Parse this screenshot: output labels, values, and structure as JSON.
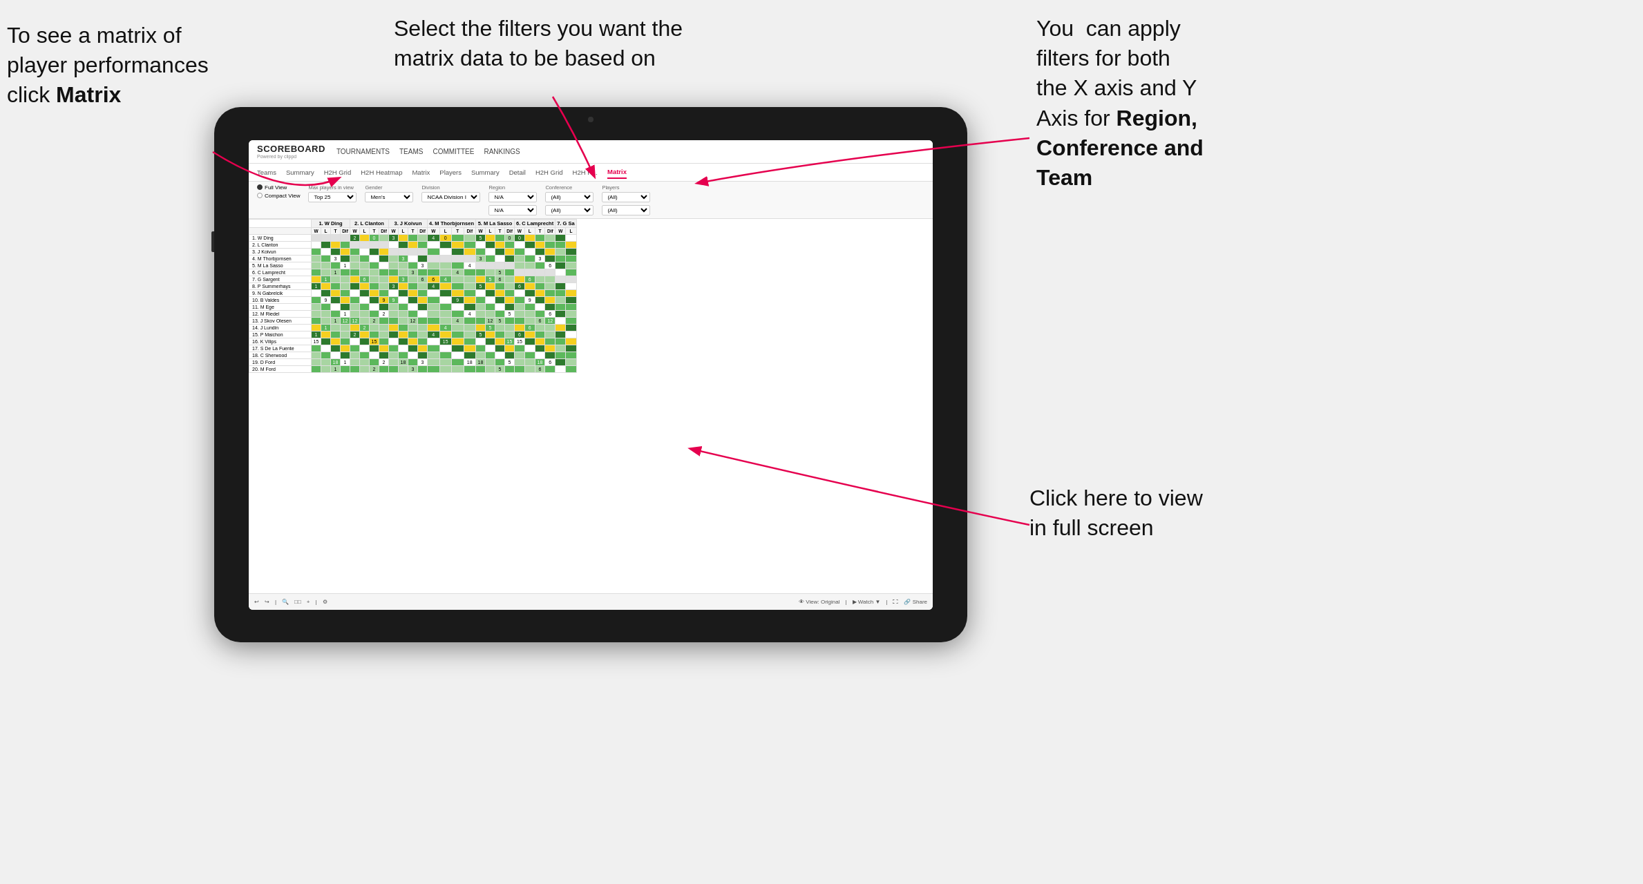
{
  "annotations": {
    "top_left": {
      "line1": "To see a matrix of",
      "line2": "player performances",
      "line3_plain": "click ",
      "line3_bold": "Matrix"
    },
    "top_center": "Select the filters you want the matrix data to be based on",
    "top_right": {
      "line1": "You  can apply",
      "line2": "filters for both",
      "line3": "the X axis and Y",
      "line4_plain": "Axis for ",
      "line4_bold": "Region,",
      "line5_bold": "Conference and",
      "line6_bold": "Team"
    },
    "bottom_right": {
      "line1": "Click here to view",
      "line2": "in full screen"
    }
  },
  "app": {
    "logo_title": "SCOREBOARD",
    "logo_sub": "Powered by clippd",
    "nav_items": [
      "TOURNAMENTS",
      "TEAMS",
      "COMMITTEE",
      "RANKINGS"
    ],
    "sub_nav_items": [
      "Teams",
      "Summary",
      "H2H Grid",
      "H2H Heatmap",
      "Matrix",
      "Players",
      "Summary",
      "Detail",
      "H2H Grid",
      "H2H H...",
      "Matrix"
    ],
    "active_tab": "Matrix"
  },
  "filters": {
    "view_options": [
      "Full View",
      "Compact View"
    ],
    "selected_view": "Full View",
    "max_players_label": "Max players in view",
    "max_players_value": "Top 25",
    "gender_label": "Gender",
    "gender_value": "Men's",
    "division_label": "Division",
    "division_value": "NCAA Division I",
    "region_label": "Region",
    "region_value1": "N/A",
    "region_value2": "N/A",
    "conference_label": "Conference",
    "conference_value1": "(All)",
    "conference_value2": "(All)",
    "players_label": "Players",
    "players_value1": "(All)",
    "players_value2": "(All)"
  },
  "matrix": {
    "column_headers": [
      "1. W Ding",
      "2. L Clanton",
      "3. J Koivun",
      "4. M Thorbjornsen",
      "5. M La Sasso",
      "6. C Lamprecht",
      "7. G Sa"
    ],
    "sub_headers": [
      "W",
      "L",
      "T",
      "Dif"
    ],
    "row_players": [
      "1. W Ding",
      "2. L Clanton",
      "3. J Koivun",
      "4. M Thorbjornsen",
      "5. M La Sasso",
      "6. C Lamprecht",
      "7. G Sargent",
      "8. P Summerhays",
      "9. N Gabrelcik",
      "10. B Valdes",
      "11. M Ege",
      "12. M Riedel",
      "13. J Skov Olesen",
      "14. J Lundin",
      "15. P Maichon",
      "16. K Vilips",
      "17. S De La Fuente",
      "18. C Sherwood",
      "19. D Ford",
      "20. M Ford"
    ]
  },
  "toolbar": {
    "view_original": "View: Original",
    "watch": "Watch",
    "share": "Share"
  }
}
